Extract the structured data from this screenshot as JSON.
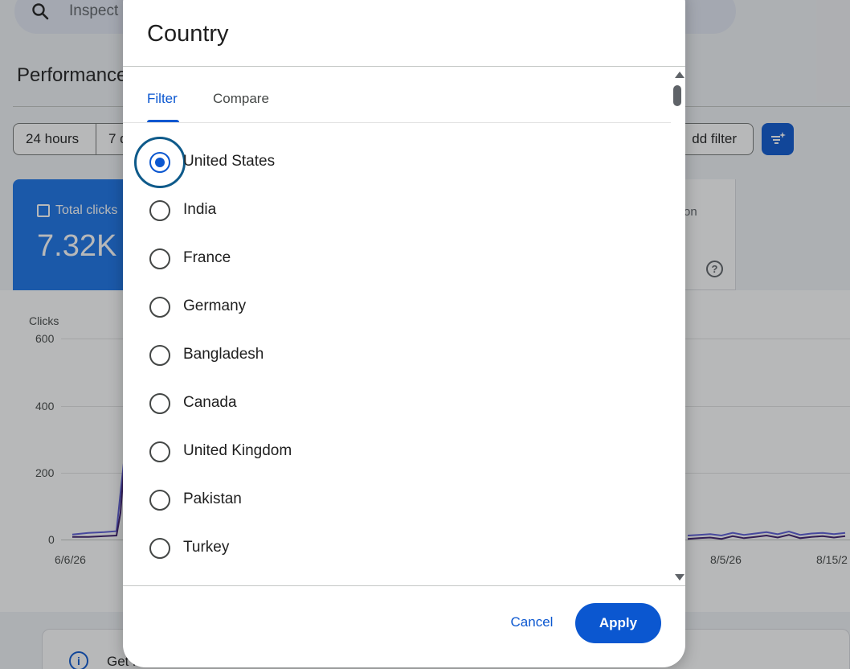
{
  "background": {
    "search_placeholder": "Inspect",
    "page_title": "Performance",
    "date_chips": [
      "24 hours",
      "7 d"
    ],
    "add_filter_label": "dd filter",
    "metric": {
      "label": "Total clicks",
      "value": "7.32K"
    },
    "right_card_fragment": "on",
    "chart_data": {
      "type": "line",
      "title": "",
      "ylabel": "Clicks",
      "ylim": [
        0,
        600
      ],
      "y_ticks": [
        "600",
        "400",
        "200",
        "0"
      ],
      "x_ticks": [
        "6/6/26",
        "8/5/26",
        "8/15/2"
      ],
      "series": [
        {
          "color": "#5b5bd6",
          "values": [
            15,
            20,
            22,
            25,
            140,
            250
          ]
        },
        {
          "color": "#3c1b6e",
          "values": [
            8,
            8,
            10,
            12,
            80,
            240
          ]
        }
      ],
      "visible_right_values": [
        12,
        14,
        16,
        12,
        20,
        14,
        18,
        22,
        16,
        24,
        14,
        18,
        20,
        16,
        20
      ],
      "grid": true
    },
    "info_text": "Get n"
  },
  "dialog": {
    "title": "Country",
    "tabs": [
      {
        "label": "Filter",
        "active": true
      },
      {
        "label": "Compare",
        "active": false
      }
    ],
    "options": [
      {
        "label": "United States",
        "checked": true
      },
      {
        "label": "India",
        "checked": false
      },
      {
        "label": "France",
        "checked": false
      },
      {
        "label": "Germany",
        "checked": false
      },
      {
        "label": "Bangladesh",
        "checked": false
      },
      {
        "label": "Canada",
        "checked": false
      },
      {
        "label": "United Kingdom",
        "checked": false
      },
      {
        "label": "Pakistan",
        "checked": false
      },
      {
        "label": "Turkey",
        "checked": false
      }
    ],
    "cancel_label": "Cancel",
    "apply_label": "Apply"
  },
  "colors": {
    "primary": "#0b57d0",
    "metric_card": "#1a73e8",
    "focus_ring": "#0e5a8a"
  }
}
